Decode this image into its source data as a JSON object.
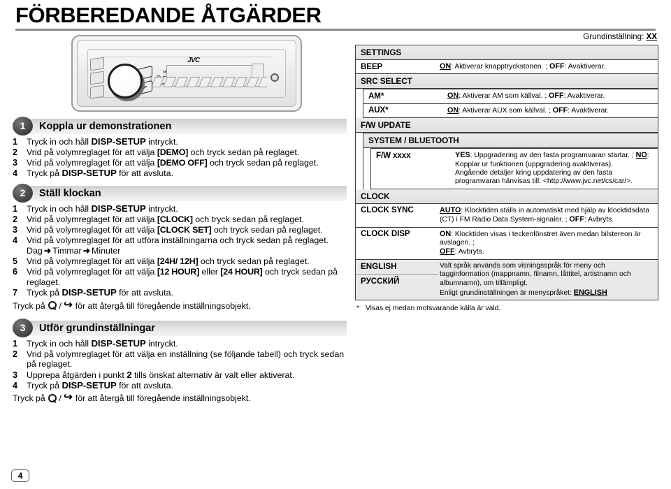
{
  "page": {
    "title": "FÖRBEREDANDE ÅTGÄRDER",
    "number": "4"
  },
  "stereo": {
    "brand": "JVC",
    "button_disp": "DISP",
    "micro_select": "SELECT",
    "micro_mode": "•••",
    "micro_setup": "SETUP"
  },
  "sections": [
    {
      "badge": "1",
      "title": "Koppla ur demonstrationen",
      "steps": [
        {
          "num": "1",
          "pre": "Tryck in och håll ",
          "key": "DISP-SETUP",
          "post": " intryckt."
        },
        {
          "num": "2",
          "pre": "Vrid på volymreglaget för att välja ",
          "key": "[DEMO]",
          "post": " och tryck sedan på reglaget.",
          "keystyle": "brkt"
        },
        {
          "num": "3",
          "pre": "Vrid på volymreglaget för att välja ",
          "key": "[DEMO OFF]",
          "post": " och tryck sedan på reglaget.",
          "keystyle": "brkt"
        },
        {
          "num": "4",
          "pre": "Tryck på ",
          "key": "DISP-SETUP",
          "post": " för att avsluta."
        }
      ]
    },
    {
      "badge": "2",
      "title": "Ställ klockan",
      "steps": [
        {
          "num": "1",
          "pre": "Tryck in och håll ",
          "key": "DISP-SETUP",
          "post": " intryckt."
        },
        {
          "num": "2",
          "pre": "Vrid på volymreglaget för att välja ",
          "key": "[CLOCK]",
          "post": " och tryck sedan på reglaget.",
          "keystyle": "brkt"
        },
        {
          "num": "3",
          "pre": "Vrid på volymreglaget för att välja ",
          "key": "[CLOCK SET]",
          "post": " och tryck sedan på reglaget.",
          "keystyle": "brkt"
        },
        {
          "num": "4",
          "pre": "Vrid på volymreglaget för att utföra inställningarna och tryck sedan på reglaget.",
          "key": "",
          "post": ""
        },
        {
          "num": "5",
          "pre": "Vrid på volymreglaget för att välja ",
          "key": "[24H/ 12H]",
          "post": " och tryck sedan på reglaget.",
          "keystyle": "brkt"
        },
        {
          "num": "6",
          "pre": "Vrid på volymreglaget för att välja ",
          "key": "[12 HOUR]",
          "mid": " eller ",
          "key2": "[24 HOUR]",
          "post": " och tryck sedan på reglaget.",
          "keystyle": "brkt"
        },
        {
          "num": "7",
          "pre": "Tryck på ",
          "key": "DISP-SETUP",
          "post": " för att avsluta."
        }
      ],
      "sub_sequence": {
        "a": "Dag",
        "b": "Timmar",
        "c": "Minuter",
        "arrow": "➜"
      },
      "note_pre": "Tryck på ",
      "note_post": " för att återgå till föregående inställningsobjekt.",
      "note_sep": " / "
    },
    {
      "badge": "3",
      "title": "Utför grundinställningar",
      "steps": [
        {
          "num": "1",
          "pre": "Tryck in och håll ",
          "key": "DISP-SETUP",
          "post": " intryckt."
        },
        {
          "num": "2",
          "pre": "Vrid på volymreglaget för att välja en inställning (se följande tabell) och tryck sedan på reglaget.",
          "key": "",
          "post": ""
        },
        {
          "num": "3",
          "pre": "Upprepa åtgärden i punkt ",
          "key": "2",
          "post": " tills önskat alternativ är valt eller aktiverat."
        },
        {
          "num": "4",
          "pre": "Tryck på ",
          "key": "DISP-SETUP",
          "post": " för att avsluta."
        }
      ],
      "note_pre": "Tryck på ",
      "note_post": " för att återgå till föregående inställningsobjekt.",
      "note_sep": " / "
    }
  ],
  "settings_table": {
    "default_note_text": "Grundinställning: ",
    "default_note_value": "XX",
    "root_title": "SETTINGS",
    "rows": [
      {
        "type": "row",
        "label": "BEEP",
        "desc_parts": [
          {
            "t": "ON",
            "style": "bold-underline"
          },
          {
            "t": ": Aktiverar knapptryckstonen. ; ",
            "style": "plain"
          },
          {
            "t": "OFF",
            "style": "bold"
          },
          {
            "t": ": Avaktiverar.",
            "style": "plain"
          }
        ]
      },
      {
        "type": "group",
        "label": "SRC SELECT",
        "children": [
          {
            "type": "row",
            "label": "AM*",
            "desc_parts": [
              {
                "t": "ON",
                "style": "bold-underline"
              },
              {
                "t": ": Aktiverar AM som källval. ; ",
                "style": "plain"
              },
              {
                "t": "OFF",
                "style": "bold"
              },
              {
                "t": ": Avaktiverar.",
                "style": "plain"
              }
            ]
          },
          {
            "type": "row",
            "label": "AUX*",
            "desc_parts": [
              {
                "t": "ON",
                "style": "bold-underline"
              },
              {
                "t": ": Aktiverar AUX som källval. ; ",
                "style": "plain"
              },
              {
                "t": "OFF",
                "style": "bold"
              },
              {
                "t": ": Avaktiverar.",
                "style": "plain"
              }
            ]
          }
        ]
      },
      {
        "type": "group",
        "label": "F/W UPDATE",
        "children": [
          {
            "type": "group",
            "label": "SYSTEM / BLUETOOTH",
            "children": [
              {
                "type": "row",
                "label": "F/W xxxx",
                "desc_parts": [
                  {
                    "t": "YES",
                    "style": "bold"
                  },
                  {
                    "t": ": Uppgradering av den fasta programvaran startar. ; ",
                    "style": "plain"
                  },
                  {
                    "t": "NO",
                    "style": "bold-underline"
                  },
                  {
                    "t": ": Kopplar ur funktionen (uppgradering avaktiveras).",
                    "style": "plain"
                  },
                  {
                    "t": "BR",
                    "style": "break"
                  },
                  {
                    "t": "Angående detaljer kring uppdatering av den fasta programvaran hänvisas till: <http://www.jvc.net/cs/car/>.",
                    "style": "plain"
                  }
                ]
              }
            ]
          }
        ]
      },
      {
        "type": "group",
        "label": "CLOCK",
        "children": []
      },
      {
        "type": "row",
        "label": "CLOCK SYNC",
        "desc_parts": [
          {
            "t": "AUTO",
            "style": "bold-underline"
          },
          {
            "t": ": Klocktiden ställs in automatiskt med hjälp av klocktidsdata (CT) i FM Radio Data System-signaler. ; ",
            "style": "plain"
          },
          {
            "t": "OFF",
            "style": "bold"
          },
          {
            "t": ": Avbryts.",
            "style": "plain"
          }
        ]
      },
      {
        "type": "row",
        "label": "CLOCK DISP",
        "desc_parts": [
          {
            "t": "ON",
            "style": "bold"
          },
          {
            "t": ": Klocktiden visas i teckenfönstret även medan bilstereon är avslagen. ; ",
            "style": "plain"
          },
          {
            "t": "BR",
            "style": "break"
          },
          {
            "t": "OFF",
            "style": "bold-underline"
          },
          {
            "t": ": Avbryts.",
            "style": "plain"
          }
        ]
      }
    ],
    "language_block": {
      "label_1": "ENGLISH",
      "label_2": "РУССКИЙ",
      "desc_line1": "Valt språk används som visningsspråk för meny och tagginformation (mappnamn, filnamn, låttitel, artistnamn och albumnamn), om tillämpligt.",
      "desc_line2_pre": "Enligt grundinställningen är menyspråket: ",
      "desc_line2_value": "ENGLISH"
    },
    "footnote_star": "*",
    "footnote_text": "Visas ej medan motsvarande källa är vald."
  }
}
